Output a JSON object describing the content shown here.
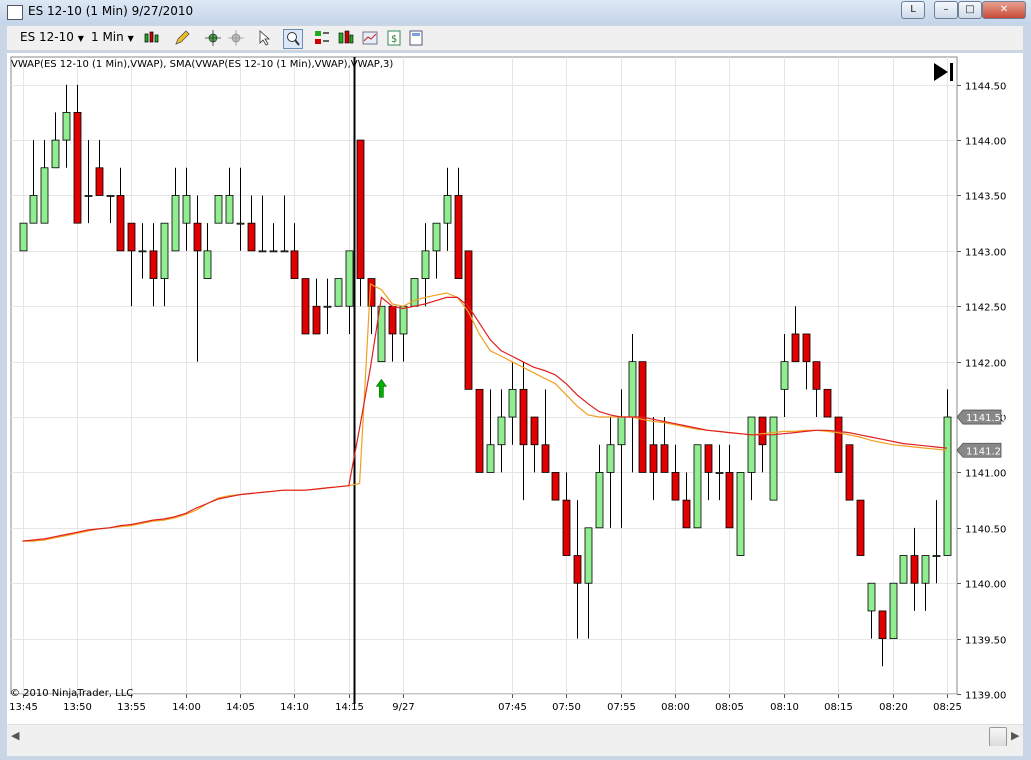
{
  "window": {
    "title": "ES 12-10 (1 Min)  9/27/2010",
    "restore_label": "L"
  },
  "toolbar": {
    "instrument": "ES 12-10",
    "interval": "1 Min"
  },
  "chart_data": {
    "type": "candlestick",
    "indicator_label": "VWAP(ES 12-10 (1 Min),VWAP), SMA(VWAP(ES 12-10 (1 Min),VWAP),VWAP,3)",
    "copyright": "© 2010 NinjaTrader, LLC",
    "ylim": [
      1139.0,
      1144.75
    ],
    "y_ticks": [
      1139.0,
      1139.5,
      1140.0,
      1140.5,
      1141.0,
      1141.5,
      1142.0,
      1142.5,
      1143.0,
      1143.5,
      1144.0,
      1144.5
    ],
    "x_tick_labels": [
      "13:45",
      "13:50",
      "13:55",
      "14:00",
      "14:05",
      "14:10",
      "14:15",
      "9/27",
      "07:45",
      "07:50",
      "07:55",
      "08:00",
      "08:05",
      "08:10",
      "08:15",
      "08:20",
      "08:25"
    ],
    "x_tick_bar_index": [
      0,
      5,
      10,
      15,
      20,
      25,
      30,
      35,
      45,
      50,
      55,
      60,
      65,
      70,
      75,
      80,
      85
    ],
    "session_break_index": 30.5,
    "up_color": "#90ee90",
    "down_color": "#e00000",
    "vwap_color": "#e02020",
    "sma_color": "#f0a020",
    "last_price_labels": [
      {
        "price": 1141.5,
        "label": "1141.50"
      },
      {
        "price": 1141.2,
        "label": "1141.20"
      }
    ],
    "signal_arrow": {
      "bar_index": 33,
      "price": 1141.75,
      "direction": "up",
      "color": "#00b000"
    },
    "bars": [
      {
        "o": 1143.0,
        "h": 1143.25,
        "l": 1143.0,
        "c": 1143.25
      },
      {
        "o": 1143.25,
        "h": 1144.0,
        "l": 1143.25,
        "c": 1143.5
      },
      {
        "o": 1143.25,
        "h": 1144.0,
        "l": 1143.25,
        "c": 1143.75
      },
      {
        "o": 1143.75,
        "h": 1144.25,
        "l": 1143.75,
        "c": 1144.0
      },
      {
        "o": 1144.0,
        "h": 1144.5,
        "l": 1143.75,
        "c": 1144.25
      },
      {
        "o": 1144.25,
        "h": 1144.5,
        "l": 1143.25,
        "c": 1143.25
      },
      {
        "o": 1143.5,
        "h": 1144.0,
        "l": 1143.25,
        "c": 1143.5
      },
      {
        "o": 1143.75,
        "h": 1144.0,
        "l": 1143.5,
        "c": 1143.5
      },
      {
        "o": 1143.5,
        "h": 1143.5,
        "l": 1143.25,
        "c": 1143.5
      },
      {
        "o": 1143.5,
        "h": 1143.75,
        "l": 1143.0,
        "c": 1143.0
      },
      {
        "o": 1143.25,
        "h": 1143.25,
        "l": 1142.5,
        "c": 1143.0
      },
      {
        "o": 1143.0,
        "h": 1143.25,
        "l": 1142.75,
        "c": 1143.0
      },
      {
        "o": 1143.0,
        "h": 1143.25,
        "l": 1142.5,
        "c": 1142.75
      },
      {
        "o": 1142.75,
        "h": 1143.25,
        "l": 1142.5,
        "c": 1143.25
      },
      {
        "o": 1143.0,
        "h": 1143.75,
        "l": 1143.0,
        "c": 1143.5
      },
      {
        "o": 1143.25,
        "h": 1143.75,
        "l": 1143.0,
        "c": 1143.5
      },
      {
        "o": 1143.25,
        "h": 1143.5,
        "l": 1142.0,
        "c": 1143.0
      },
      {
        "o": 1142.75,
        "h": 1143.25,
        "l": 1142.75,
        "c": 1143.0
      },
      {
        "o": 1143.25,
        "h": 1143.5,
        "l": 1143.25,
        "c": 1143.5
      },
      {
        "o": 1143.25,
        "h": 1143.75,
        "l": 1143.25,
        "c": 1143.5
      },
      {
        "o": 1143.25,
        "h": 1143.75,
        "l": 1143.0,
        "c": 1143.25
      },
      {
        "o": 1143.25,
        "h": 1143.5,
        "l": 1143.0,
        "c": 1143.0
      },
      {
        "o": 1143.0,
        "h": 1143.5,
        "l": 1143.0,
        "c": 1143.0
      },
      {
        "o": 1143.0,
        "h": 1143.25,
        "l": 1143.0,
        "c": 1143.0
      },
      {
        "o": 1143.0,
        "h": 1143.5,
        "l": 1143.0,
        "c": 1143.0
      },
      {
        "o": 1143.0,
        "h": 1143.25,
        "l": 1142.75,
        "c": 1142.75
      },
      {
        "o": 1142.75,
        "h": 1142.75,
        "l": 1142.25,
        "c": 1142.25
      },
      {
        "o": 1142.5,
        "h": 1142.75,
        "l": 1142.25,
        "c": 1142.25
      },
      {
        "o": 1142.5,
        "h": 1142.75,
        "l": 1142.25,
        "c": 1142.5
      },
      {
        "o": 1142.5,
        "h": 1142.75,
        "l": 1142.5,
        "c": 1142.75
      },
      {
        "o": 1142.5,
        "h": 1143.0,
        "l": 1142.25,
        "c": 1143.0
      },
      {
        "o": 1144.0,
        "h": 1144.0,
        "l": 1142.5,
        "c": 1142.75
      },
      {
        "o": 1142.75,
        "h": 1142.75,
        "l": 1142.25,
        "c": 1142.5
      },
      {
        "o": 1142.0,
        "h": 1142.5,
        "l": 1142.0,
        "c": 1142.5
      },
      {
        "o": 1142.5,
        "h": 1142.5,
        "l": 1142.0,
        "c": 1142.25
      },
      {
        "o": 1142.25,
        "h": 1142.5,
        "l": 1142.0,
        "c": 1142.5
      },
      {
        "o": 1142.5,
        "h": 1142.75,
        "l": 1142.5,
        "c": 1142.75
      },
      {
        "o": 1142.75,
        "h": 1143.25,
        "l": 1142.5,
        "c": 1143.0
      },
      {
        "o": 1143.0,
        "h": 1143.25,
        "l": 1142.75,
        "c": 1143.25
      },
      {
        "o": 1143.25,
        "h": 1143.75,
        "l": 1143.0,
        "c": 1143.5
      },
      {
        "o": 1143.5,
        "h": 1143.75,
        "l": 1142.75,
        "c": 1142.75
      },
      {
        "o": 1143.0,
        "h": 1143.0,
        "l": 1141.75,
        "c": 1141.75
      },
      {
        "o": 1141.75,
        "h": 1141.75,
        "l": 1141.0,
        "c": 1141.0
      },
      {
        "o": 1141.0,
        "h": 1141.75,
        "l": 1141.0,
        "c": 1141.25
      },
      {
        "o": 1141.25,
        "h": 1141.75,
        "l": 1141.0,
        "c": 1141.5
      },
      {
        "o": 1141.5,
        "h": 1142.0,
        "l": 1141.25,
        "c": 1141.75
      },
      {
        "o": 1141.75,
        "h": 1142.0,
        "l": 1140.75,
        "c": 1141.25
      },
      {
        "o": 1141.5,
        "h": 1141.5,
        "l": 1141.0,
        "c": 1141.25
      },
      {
        "o": 1141.25,
        "h": 1141.75,
        "l": 1141.0,
        "c": 1141.0
      },
      {
        "o": 1141.0,
        "h": 1141.0,
        "l": 1140.75,
        "c": 1140.75
      },
      {
        "o": 1140.75,
        "h": 1141.0,
        "l": 1140.25,
        "c": 1140.25
      },
      {
        "o": 1140.25,
        "h": 1140.75,
        "l": 1139.5,
        "c": 1140.0
      },
      {
        "o": 1140.0,
        "h": 1140.25,
        "l": 1139.5,
        "c": 1140.5
      },
      {
        "o": 1140.5,
        "h": 1141.25,
        "l": 1140.5,
        "c": 1141.0
      },
      {
        "o": 1141.0,
        "h": 1141.5,
        "l": 1140.5,
        "c": 1141.25
      },
      {
        "o": 1141.25,
        "h": 1141.75,
        "l": 1140.5,
        "c": 1141.5
      },
      {
        "o": 1141.5,
        "h": 1142.25,
        "l": 1141.0,
        "c": 1142.0
      },
      {
        "o": 1142.0,
        "h": 1142.0,
        "l": 1141.0,
        "c": 1141.0
      },
      {
        "o": 1141.25,
        "h": 1141.5,
        "l": 1140.75,
        "c": 1141.0
      },
      {
        "o": 1141.25,
        "h": 1141.5,
        "l": 1141.0,
        "c": 1141.0
      },
      {
        "o": 1141.0,
        "h": 1141.25,
        "l": 1140.75,
        "c": 1140.75
      },
      {
        "o": 1140.75,
        "h": 1141.0,
        "l": 1140.5,
        "c": 1140.5
      },
      {
        "o": 1140.5,
        "h": 1141.25,
        "l": 1140.5,
        "c": 1141.25
      },
      {
        "o": 1141.25,
        "h": 1141.25,
        "l": 1140.75,
        "c": 1141.0
      },
      {
        "o": 1141.0,
        "h": 1141.25,
        "l": 1140.75,
        "c": 1141.0
      },
      {
        "o": 1141.0,
        "h": 1141.25,
        "l": 1140.5,
        "c": 1140.5
      },
      {
        "o": 1140.25,
        "h": 1141.0,
        "l": 1140.25,
        "c": 1141.0
      },
      {
        "o": 1141.0,
        "h": 1141.5,
        "l": 1140.75,
        "c": 1141.5
      },
      {
        "o": 1141.5,
        "h": 1141.5,
        "l": 1141.0,
        "c": 1141.25
      },
      {
        "o": 1140.75,
        "h": 1141.5,
        "l": 1140.75,
        "c": 1141.5
      },
      {
        "o": 1141.75,
        "h": 1142.25,
        "l": 1141.5,
        "c": 1142.0
      },
      {
        "o": 1142.25,
        "h": 1142.5,
        "l": 1142.0,
        "c": 1142.0
      },
      {
        "o": 1142.25,
        "h": 1142.25,
        "l": 1141.75,
        "c": 1142.0
      },
      {
        "o": 1142.0,
        "h": 1142.0,
        "l": 1141.5,
        "c": 1141.75
      },
      {
        "o": 1141.75,
        "h": 1141.75,
        "l": 1141.5,
        "c": 1141.5
      },
      {
        "o": 1141.5,
        "h": 1141.5,
        "l": 1141.0,
        "c": 1141.0
      },
      {
        "o": 1141.25,
        "h": 1141.25,
        "l": 1140.75,
        "c": 1140.75
      },
      {
        "o": 1140.75,
        "h": 1140.75,
        "l": 1140.25,
        "c": 1140.25
      },
      {
        "o": 1139.75,
        "h": 1140.0,
        "l": 1139.5,
        "c": 1140.0
      },
      {
        "o": 1139.75,
        "h": 1139.75,
        "l": 1139.25,
        "c": 1139.5
      },
      {
        "o": 1139.5,
        "h": 1140.0,
        "l": 1139.5,
        "c": 1140.0
      },
      {
        "o": 1140.0,
        "h": 1140.25,
        "l": 1140.0,
        "c": 1140.25
      },
      {
        "o": 1140.25,
        "h": 1140.5,
        "l": 1139.75,
        "c": 1140.0
      },
      {
        "o": 1140.0,
        "h": 1140.25,
        "l": 1139.75,
        "c": 1140.25
      },
      {
        "o": 1140.25,
        "h": 1140.75,
        "l": 1140.0,
        "c": 1140.25
      },
      {
        "o": 1140.25,
        "h": 1141.75,
        "l": 1140.25,
        "c": 1141.5
      }
    ],
    "vwap": [
      1140.38,
      1140.39,
      1140.4,
      1140.42,
      1140.44,
      1140.46,
      1140.48,
      1140.49,
      1140.5,
      1140.52,
      1140.53,
      1140.55,
      1140.57,
      1140.58,
      1140.6,
      1140.63,
      1140.68,
      1140.72,
      1140.76,
      1140.78,
      1140.8,
      1140.81,
      1140.82,
      1140.83,
      1140.84,
      1140.84,
      1140.84,
      1140.85,
      1140.86,
      1140.87,
      1140.88,
      1141.4,
      1141.95,
      1142.58,
      1142.5,
      1142.48,
      1142.5,
      1142.52,
      1142.55,
      1142.58,
      1142.58,
      1142.5,
      1142.35,
      1142.2,
      1142.1,
      1142.05,
      1142.0,
      1141.95,
      1141.92,
      1141.88,
      1141.8,
      1141.7,
      1141.62,
      1141.55,
      1141.52,
      1141.5,
      1141.5,
      1141.5,
      1141.48,
      1141.46,
      1141.44,
      1141.42,
      1141.4,
      1141.38,
      1141.37,
      1141.36,
      1141.35,
      1141.34,
      1141.34,
      1141.34,
      1141.35,
      1141.36,
      1141.37,
      1141.38,
      1141.38,
      1141.37,
      1141.36,
      1141.34,
      1141.32,
      1141.3,
      1141.28,
      1141.26,
      1141.25,
      1141.24,
      1141.23,
      1141.22
    ],
    "sma": [
      1140.38,
      1140.38,
      1140.39,
      1140.41,
      1140.43,
      1140.45,
      1140.47,
      1140.49,
      1140.5,
      1140.51,
      1140.52,
      1140.54,
      1140.56,
      1140.57,
      1140.59,
      1140.62,
      1140.66,
      1140.72,
      1140.77,
      1140.79,
      1140.8,
      1140.81,
      1140.82,
      1140.83,
      1140.84,
      1140.84,
      1140.84,
      1140.85,
      1140.86,
      1140.87,
      1140.88,
      1140.9,
      1142.7,
      1142.65,
      1142.52,
      1142.5,
      1142.55,
      1142.58,
      1142.6,
      1142.62,
      1142.58,
      1142.45,
      1142.25,
      1142.1,
      1142.05,
      1142.0,
      1141.95,
      1141.9,
      1141.85,
      1141.8,
      1141.7,
      1141.6,
      1141.52,
      1141.5,
      1141.5,
      1141.5,
      1141.5,
      1141.48,
      1141.46,
      1141.45,
      1141.43,
      1141.41,
      1141.39,
      1141.38,
      1141.37,
      1141.36,
      1141.35,
      1141.34,
      1141.35,
      1141.36,
      1141.37,
      1141.37,
      1141.38,
      1141.38,
      1141.37,
      1141.36,
      1141.34,
      1141.32,
      1141.29,
      1141.27,
      1141.25,
      1141.24,
      1141.23,
      1141.22,
      1141.21,
      1141.2
    ]
  }
}
